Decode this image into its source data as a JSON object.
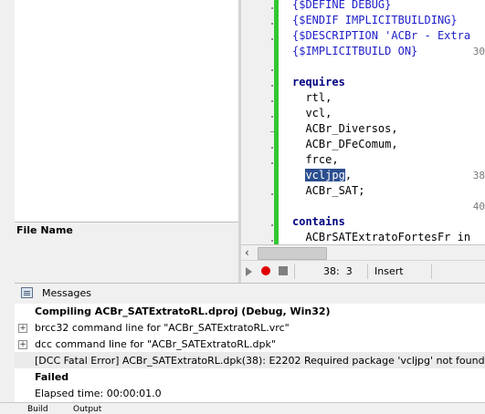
{
  "file_panel": {
    "header": "File Name"
  },
  "editor": {
    "lines": [
      {
        "n": "",
        "text": "{$DEFINE DEBUG}"
      },
      {
        "n": "",
        "text": "{$ENDIF IMPLICITBUILDING}"
      },
      {
        "n": "",
        "text": "{$DESCRIPTION 'ACBr - Extra"
      },
      {
        "n": "30",
        "text": "{$IMPLICITBUILD ON}"
      },
      {
        "n": "",
        "text": ""
      },
      {
        "n": "",
        "text": "requires"
      },
      {
        "n": "",
        "text": "  rtl,"
      },
      {
        "n": "",
        "text": "  vcl,"
      },
      {
        "n": "",
        "text": "  ACBr_Diversos,"
      },
      {
        "n": "",
        "text": "  ACBr_DFeComum,"
      },
      {
        "n": "",
        "text": "  frce,"
      },
      {
        "n": "38",
        "text_sel": "vcljpg",
        "text_after": ","
      },
      {
        "n": "",
        "text": "  ACBr_SAT;"
      },
      {
        "n": "40",
        "text": ""
      },
      {
        "n": "",
        "text": "contains"
      },
      {
        "n": "",
        "text": "  ACBrSATExtratoFortesFr in"
      }
    ]
  },
  "status": {
    "position": "38:  3",
    "mode": "Insert"
  },
  "messages": {
    "title": "Messages",
    "rows": [
      {
        "text": "Compiling ACBr_SATExtratoRL.dproj (Debug, Win32)"
      },
      {
        "text": "brcc32 command line for \"ACBr_SATExtratoRL.vrc\""
      },
      {
        "text": "dcc command line for \"ACBr_SATExtratoRL.dpk\""
      },
      {
        "text": "[DCC Fatal Error] ACBr_SATExtratoRL.dpk(38): E2202 Required package 'vcljpg' not found"
      },
      {
        "text": "Failed"
      },
      {
        "text": "Elapsed time: 00:00:01.0"
      }
    ]
  },
  "bottom_tabs": [
    "Build",
    "Output"
  ]
}
